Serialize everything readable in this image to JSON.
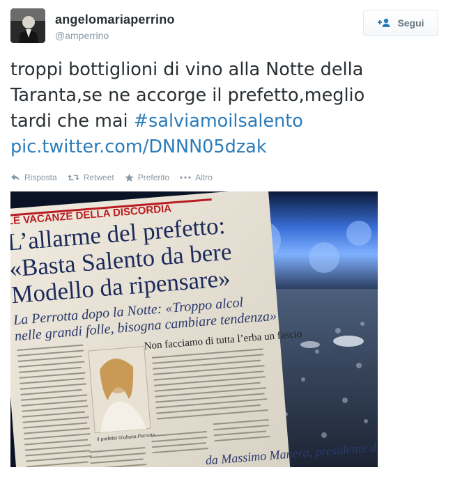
{
  "user": {
    "full_name": "angelomariaperrino",
    "screen_name": "@amperrino",
    "avatar_icon": "user-avatar"
  },
  "follow_button": {
    "label": "Segui",
    "icon": "add-user-icon"
  },
  "tweet": {
    "text_line1": "troppi bottiglioni di vino alla Notte della",
    "text_line2": "Taranta,se ne accorge il prefetto,meglio",
    "text_line3_plain": "tardi che mai ",
    "hashtag": "#salviamoilsalento",
    "pic_link": "pic.twitter.com/DNNN05dzak"
  },
  "actions": {
    "reply": "Risposta",
    "retweet": "Retweet",
    "favorite": "Preferito",
    "more": "Altro"
  },
  "photo": {
    "kicker": "LE VACANZE DELLA DISCORDIA",
    "headline_1": "L’allarme del prefetto:",
    "headline_2": "«Basta Salento da bere",
    "headline_3": "Modello da ripensare»",
    "subhead_1": "La Perrotta dopo la Notte: «Troppo alcol",
    "subhead_2": "nelle grandi folle, bisogna cambiare tendenza»",
    "section_title": "Non facciamo di tutta l’erba un fascio",
    "caption": "Il prefetto Giuliana Perrotta",
    "footer_text": "da Massimo Manera, presidente d",
    "colors": {
      "kicker": "#b81c22",
      "headline": "#1a2a5a",
      "subhead": "#2a3a6a"
    }
  },
  "colors": {
    "link": "#2b7bb9",
    "meta": "#8899a6",
    "text": "#292f33"
  }
}
